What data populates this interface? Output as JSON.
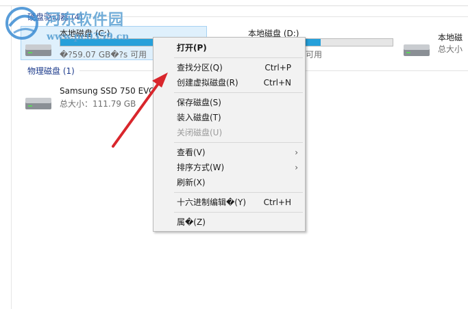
{
  "groups": {
    "devices_header": "硬盘驱动器 (4)",
    "physical_header": "物理磁盘 (1)"
  },
  "drives": [
    {
      "name": "本地磁盘 (C:)",
      "info": "�?59.07 GB�?s 可用",
      "usage": 0.75
    },
    {
      "name": "本地磁盘 (D:)",
      "info": "可用",
      "usage": 0.5
    },
    {
      "name": "本地磁",
      "info": "总大小"
    }
  ],
  "physical": [
    {
      "name": "Samsung SSD 750 EVO 120",
      "info": "总大小：111.79 GB"
    }
  ],
  "context_menu": {
    "items": [
      {
        "label": "打开(P)",
        "shortcut": "",
        "bold": true
      },
      {
        "label": "查找分区(Q)",
        "shortcut": "Ctrl+P"
      },
      {
        "label": "创建虚拟磁盘(R)",
        "shortcut": "Ctrl+N"
      },
      {
        "label": "保存磁盘(S)",
        "shortcut": ""
      },
      {
        "label": "装入磁盘(T)",
        "shortcut": ""
      },
      {
        "label": "关闭磁盘(U)",
        "shortcut": "",
        "disabled": true
      },
      {
        "label": "查看(V)",
        "shortcut": "",
        "submenu": "›"
      },
      {
        "label": "排序方式(W)",
        "shortcut": "",
        "submenu": "›"
      },
      {
        "label": "刷新(X)",
        "shortcut": ""
      },
      {
        "label": "十六进制编辑�(Y)",
        "shortcut": "Ctrl+H"
      },
      {
        "label": "属�(Z)",
        "shortcut": ""
      }
    ]
  },
  "watermark": {
    "title": "河东软件园",
    "url": "www.pc0359.cn"
  },
  "colors": {
    "accent": "#26a0da",
    "selection": "#dff0fc",
    "arrow": "#d9262c",
    "group_header": "#1e3c8c"
  }
}
